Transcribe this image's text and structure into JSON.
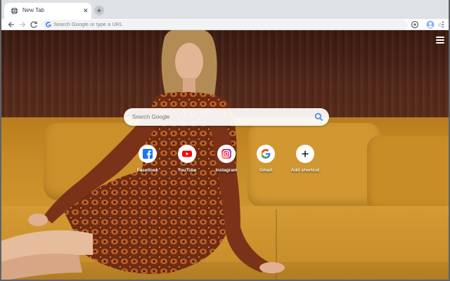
{
  "tab": {
    "title": "New Tab",
    "close_glyph": "✕",
    "icon": "globe-icon"
  },
  "new_tab_glyph": "+",
  "omnibox": {
    "placeholder": "Search Google or type a URL",
    "star_glyph": "☆"
  },
  "search": {
    "placeholder": "Search Google"
  },
  "shortcuts": [
    {
      "label": "Facebook",
      "icon": "facebook-icon",
      "color": "#1877f2"
    },
    {
      "label": "YouTube",
      "icon": "youtube-icon",
      "color": "#ff0000"
    },
    {
      "label": "Instagram",
      "icon": "instagram-icon",
      "color": "#d6249f"
    },
    {
      "label": "Gmail",
      "icon": "google-icon",
      "color": "#4285f4"
    },
    {
      "label": "Add shortcut",
      "icon": "plus-icon",
      "color": "#202124"
    }
  ],
  "colors": {
    "tabstrip": "#dee1e6",
    "wall": "#4d2415",
    "sofa": "#c9922a"
  }
}
